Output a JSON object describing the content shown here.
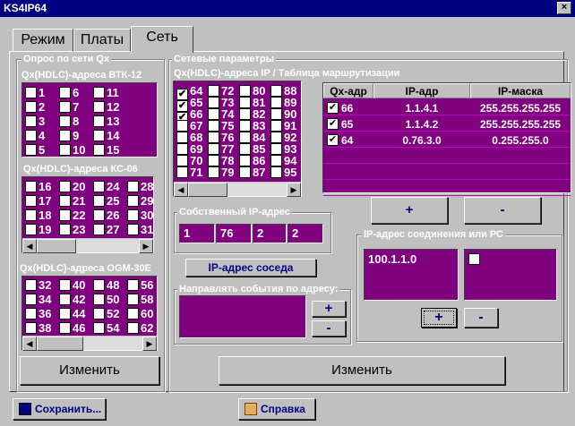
{
  "window": {
    "title": "KS4IP64",
    "close": "×"
  },
  "tabs": [
    "Режим",
    "Платы",
    "Сеть"
  ],
  "poll": {
    "title": "Опрос по сети Qx",
    "btk": {
      "title": "Qx(HDLC)-адреса ВТК-12",
      "cols": [
        [
          "1",
          "2",
          "3",
          "4",
          "5"
        ],
        [
          "6",
          "7",
          "8",
          "9",
          "10"
        ],
        [
          "11",
          "12",
          "13",
          "14",
          "15"
        ]
      ]
    },
    "kc": {
      "title": "Qx(HDLC)-адреса КС-06",
      "cols": [
        [
          "16",
          "17",
          "18",
          "19"
        ],
        [
          "20",
          "21",
          "22",
          "23"
        ],
        [
          "24",
          "25",
          "26",
          "27"
        ],
        [
          "28",
          "29",
          "30",
          "31"
        ]
      ]
    },
    "ogm": {
      "title": "Qx(HDLC)-адреса OGM-30E",
      "cols": [
        [
          "32",
          "34",
          "36",
          "38"
        ],
        [
          "40",
          "42",
          "44",
          "46"
        ],
        [
          "48",
          "50",
          "52",
          "54"
        ],
        [
          "56",
          "58",
          "60",
          "62"
        ]
      ]
    },
    "change": "Изменить"
  },
  "net": {
    "title": "Сетевые параметры",
    "ip_title": "Qx(HDLC)-адреса IP / Таблица маршрутизации",
    "ip_cols": [
      [
        "64",
        "65",
        "66",
        "67",
        "68",
        "69",
        "70",
        "71"
      ],
      [
        "72",
        "73",
        "74",
        "75",
        "76",
        "77",
        "78",
        "79"
      ],
      [
        "80",
        "81",
        "82",
        "83",
        "84",
        "85",
        "86",
        "87"
      ],
      [
        "88",
        "89",
        "90",
        "91",
        "92",
        "93",
        "94",
        "95"
      ]
    ],
    "ip_checked": [
      "64",
      "65",
      "66"
    ],
    "route_headers": [
      "Qx-адр",
      "IP-адр",
      "IP-маска"
    ],
    "routes": [
      {
        "qx": "66",
        "ip": "1.1.4.1",
        "mask": "255.255.255.255"
      },
      {
        "qx": "65",
        "ip": "1.1.4.2",
        "mask": "255.255.255.255"
      },
      {
        "qx": "64",
        "ip": "0.76.3.0",
        "mask": "0.255.255.0"
      }
    ],
    "plus": "+",
    "minus": "-",
    "own_ip_title": "Собственный IP-адрес",
    "own_ip": [
      "1",
      "76",
      "2",
      "2"
    ],
    "neighbor_button": "IP-адрес соседа",
    "events_title": "Направлять события по адресу:",
    "conn_title": "IP-адрес соединения или РС",
    "conn_address": "100.1.1.0",
    "change": "Изменить"
  },
  "bottom": {
    "save": "Сохранить...",
    "help": "Справка"
  }
}
